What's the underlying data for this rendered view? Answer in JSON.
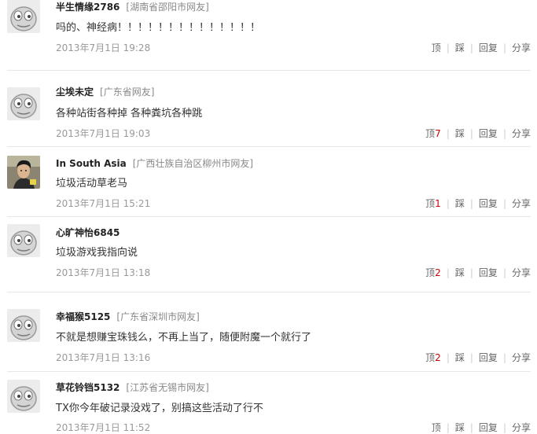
{
  "comments": [
    {
      "username": "半生情缘2786",
      "location": "[湖南省邵阳市网友]",
      "text": "吗的、神经病！！！！！！！！！！！！！！",
      "time": "2013年7月1日  19:28",
      "up_label": "顶",
      "up_count": "",
      "down_label": "踩",
      "reply_label": "回复",
      "share_label": "分享",
      "avatar": "default-avatar-icon"
    },
    {
      "username": "尘埃未定",
      "location": "[广东省网友]",
      "text": "各种站街各种掉  各种粪坑各种跳",
      "time": "2013年7月1日  19:03",
      "up_label": "顶",
      "up_count": "7",
      "down_label": "踩",
      "reply_label": "回复",
      "share_label": "分享",
      "avatar": "default-avatar-icon"
    },
    {
      "username": "In South Asia",
      "location": "[广西壮族自治区柳州市网友]",
      "text": "垃圾活动草老马",
      "time": "2013年7月1日  15:21",
      "up_label": "顶",
      "up_count": "1",
      "down_label": "踩",
      "reply_label": "回复",
      "share_label": "分享",
      "avatar": "user-photo-avatar"
    },
    {
      "username": "心旷神怡6845",
      "location": "",
      "text": "垃圾游戏我指向说",
      "time": "2013年7月1日  13:18",
      "up_label": "顶",
      "up_count": "2",
      "down_label": "踩",
      "reply_label": "回复",
      "share_label": "分享",
      "avatar": "default-avatar-icon"
    },
    {
      "username": "幸福猴5125",
      "location": "[广东省深圳市网友]",
      "text": "不就是想赚宝珠钱么，不再上当了，随便附魔一个就行了",
      "time": "2013年7月1日  13:16",
      "up_label": "顶",
      "up_count": "2",
      "down_label": "踩",
      "reply_label": "回复",
      "share_label": "分享",
      "avatar": "default-avatar-icon"
    },
    {
      "username": "草花铃铛5132",
      "location": "[江苏省无锡市网友]",
      "text": "TX你今年破记录没戏了，别搞这些活动了行不",
      "time": "2013年7月1日  11:52",
      "up_label": "顶",
      "up_count": "",
      "down_label": "踩",
      "reply_label": "回复",
      "share_label": "分享",
      "avatar": "default-avatar-icon"
    }
  ]
}
